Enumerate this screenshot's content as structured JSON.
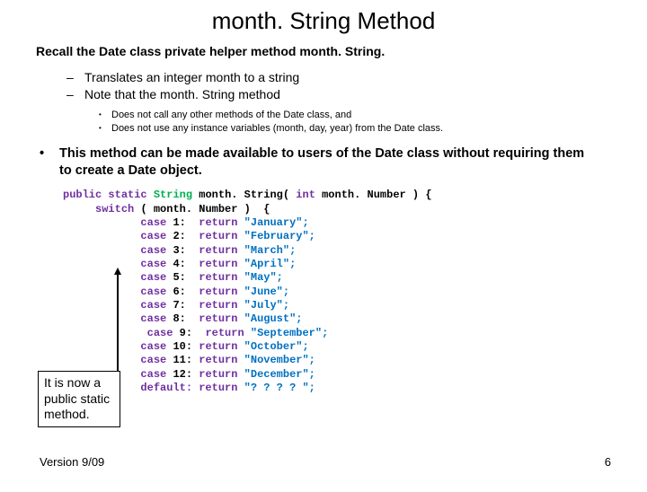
{
  "title": "month. String Method",
  "lead": "Recall the Date class private helper method month. String.",
  "dash": [
    "Translates an integer month to a string",
    "Note that the month. String method"
  ],
  "dot": [
    "Does not call any other methods of the Date class, and",
    "Does not use any instance variables (month, day, year) from the Date class."
  ],
  "main": "This method can be made available to users of the Date class without requiring them to create a Date object.",
  "code": {
    "kw_pub": "public",
    "kw_stat": "static",
    "typ_str": "String",
    "fn": "month. String(",
    "kw_int": "int",
    "param": "month. Number ) {",
    "kw_sw": "switch",
    "sw_expr": "( month. Number )  {",
    "kw_case": "case",
    "kw_ret": "return",
    "kw_def": "default:",
    "c1n": "1:",
    "c1": "\"January\";",
    "c2n": "2:",
    "c2": "\"February\";",
    "c3n": "3:",
    "c3": "\"March\";",
    "c4n": "4:",
    "c4": "\"April\";",
    "c5n": "5:",
    "c5": "\"May\";",
    "c6n": "6:",
    "c6": "\"June\";",
    "c7n": "7:",
    "c7": "\"July\";",
    "c8n": "8:",
    "c8": "\"August\";",
    "c9n": "9:",
    "c9": "\"September\";",
    "c10n": "10:",
    "c10": "\"October\";",
    "c11n": "11:",
    "c11": "\"November\";",
    "c12n": "12:",
    "c12": "\"December\";",
    "cd": "\"? ? ? ? \";",
    "brace1": "}",
    "brace2": "}"
  },
  "callout": "It is now a public static method.",
  "footer_left": "Version 9/09",
  "footer_right": "6"
}
